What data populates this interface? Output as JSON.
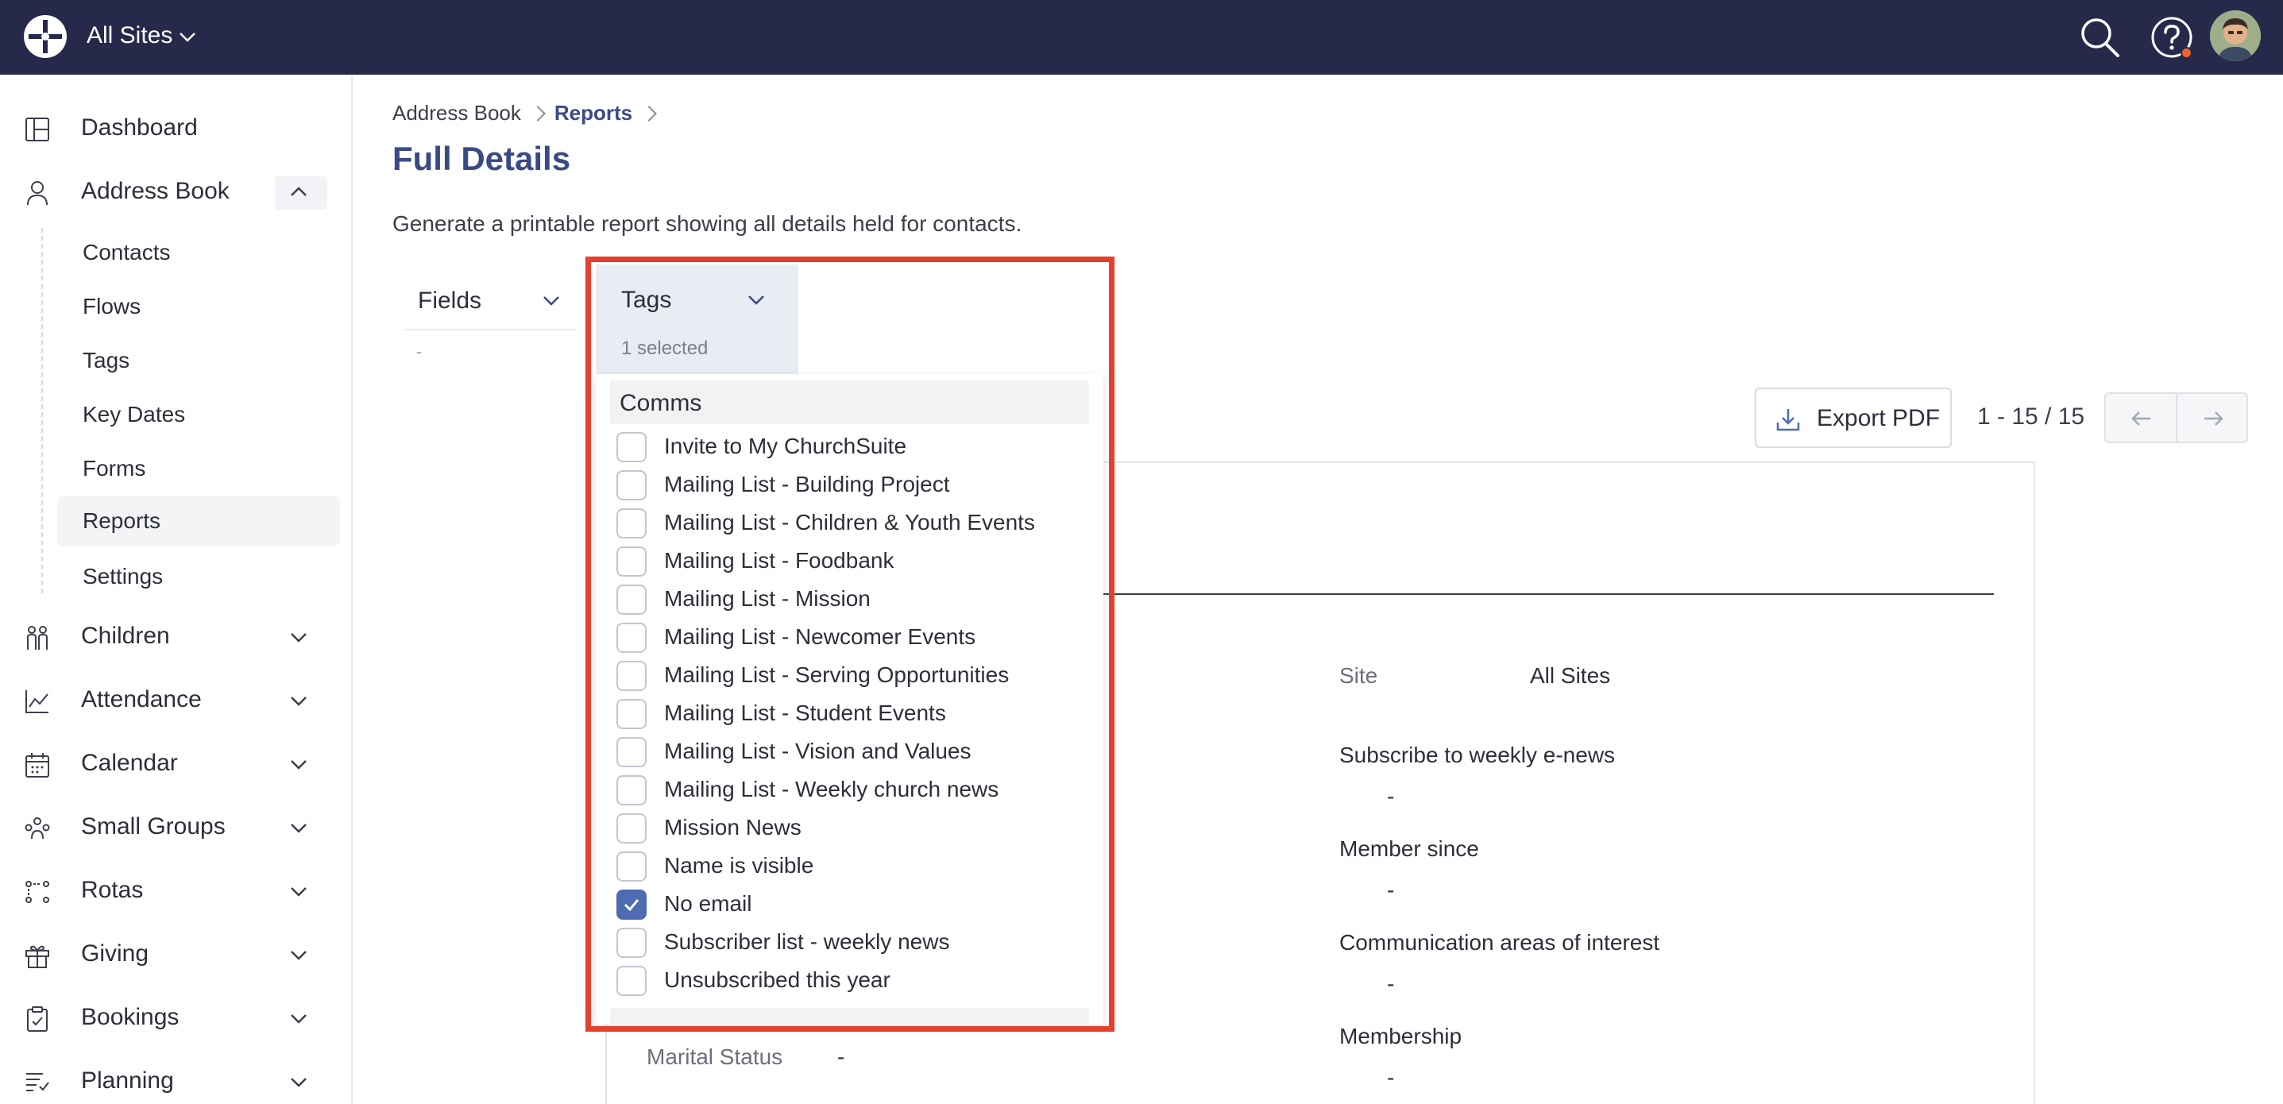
{
  "topbar": {
    "site_name": "All Sites",
    "icons": [
      "logo-icon",
      "chevron-down-icon",
      "search-icon",
      "help-icon",
      "avatar"
    ],
    "bg_color": "#26294a"
  },
  "sidebar": {
    "dashboard": "Dashboard",
    "address_book": "Address Book",
    "address_book_sub": [
      "Contacts",
      "Flows",
      "Tags",
      "Key Dates",
      "Forms",
      "Reports",
      "Settings"
    ],
    "children": "Children",
    "attendance": "Attendance",
    "calendar": "Calendar",
    "small_groups": "Small Groups",
    "rotas": "Rotas",
    "giving": "Giving",
    "bookings": "Bookings",
    "planning": "Planning"
  },
  "breadcrumb": {
    "parent": "Address Book",
    "current": "Reports"
  },
  "page": {
    "title": "Full Details",
    "description": "Generate a printable report showing all details held for contacts."
  },
  "filters": {
    "fields_label": "Fields",
    "fields_value": "-",
    "tags_label": "Tags",
    "tags_selected": "1 selected"
  },
  "toolbar": {
    "export_label": "Export PDF",
    "pager_text": "1 - 15 / 15"
  },
  "tags_dropdown": {
    "group": "Comms",
    "options": [
      {
        "label": "Invite to My ChurchSuite",
        "checked": false
      },
      {
        "label": "Mailing List - Building Project",
        "checked": false
      },
      {
        "label": "Mailing List - Children & Youth Events",
        "checked": false
      },
      {
        "label": "Mailing List - Foodbank",
        "checked": false
      },
      {
        "label": "Mailing List - Mission",
        "checked": false
      },
      {
        "label": "Mailing List - Newcomer Events",
        "checked": false
      },
      {
        "label": "Mailing List - Serving Opportunities",
        "checked": false
      },
      {
        "label": "Mailing List - Student Events",
        "checked": false
      },
      {
        "label": "Mailing List - Vision and Values",
        "checked": false
      },
      {
        "label": "Mailing List - Weekly church news",
        "checked": false
      },
      {
        "label": "Mission News",
        "checked": false
      },
      {
        "label": "Name is visible",
        "checked": false
      },
      {
        "label": "No email",
        "checked": true
      },
      {
        "label": "Subscriber list - weekly news",
        "checked": false
      },
      {
        "label": "Unsubscribed this year",
        "checked": false
      }
    ],
    "highlight_color": "#e5402b"
  },
  "report": {
    "site_label": "Site",
    "site_value": "All Sites",
    "enews_label": "Subscribe to weekly e-news",
    "enews_value": "-",
    "member_since_label": "Member since",
    "member_since_value": "-",
    "comm_areas_label": "Communication areas of interest",
    "comm_areas_value": "-",
    "membership_label": "Membership",
    "membership_value": "-",
    "marital_label": "Marital Status",
    "marital_value": "-"
  }
}
